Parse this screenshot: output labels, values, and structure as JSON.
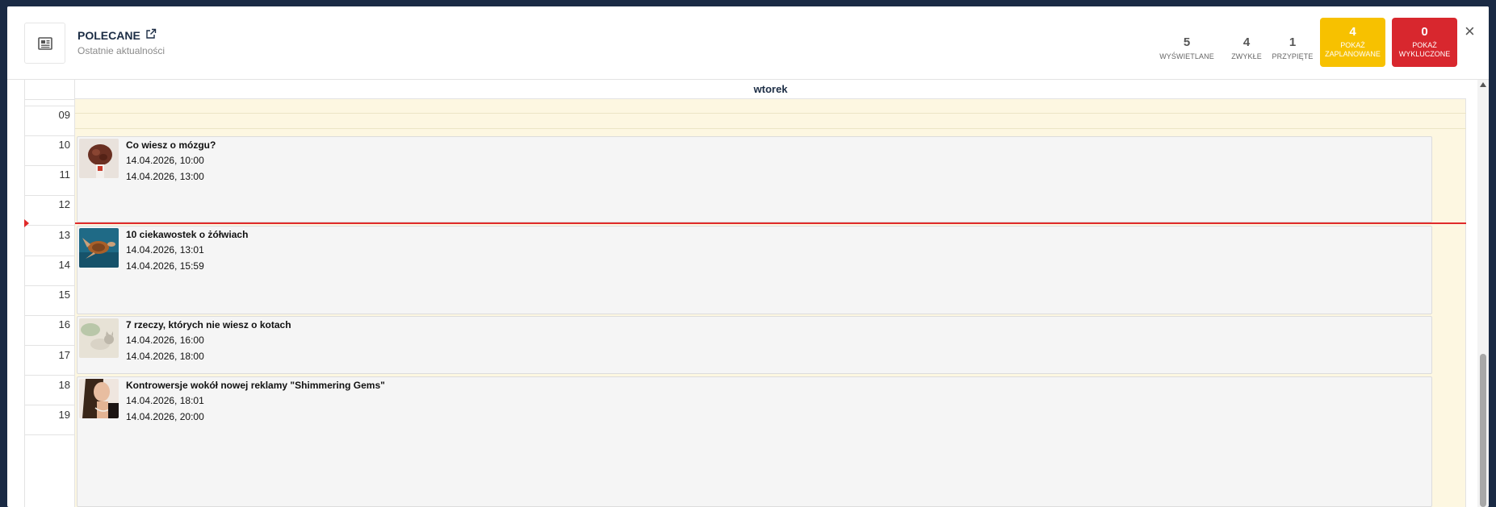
{
  "header": {
    "title": "POLECANE",
    "subtitle": "Ostatnie aktualności",
    "stats": [
      {
        "num": "5",
        "label": "WYŚWIETLANE"
      },
      {
        "num": "4",
        "label": "ZWYKŁE"
      },
      {
        "num": "1",
        "label": "PRZYPIĘTE"
      }
    ],
    "btn_planned": {
      "num": "4",
      "label1": "POKAŻ",
      "label2": "ZAPLANOWANE",
      "color": "#f7c100"
    },
    "btn_excluded": {
      "num": "0",
      "label1": "POKAŻ",
      "label2": "WYKLUCZONE",
      "color": "#d8272e"
    },
    "close": "×"
  },
  "calendar": {
    "day": "wtorek",
    "hours": [
      "09",
      "10",
      "11",
      "12",
      "13",
      "14",
      "15",
      "16",
      "17",
      "18",
      "19"
    ],
    "events": [
      {
        "title": "Co wiesz o mózgu?",
        "start": "14.04.2026, 10:00",
        "end": "14.04.2026, 13:00",
        "thumb": "brain"
      },
      {
        "title": "10 ciekawostek o żółwiach",
        "start": "14.04.2026, 13:01",
        "end": "14.04.2026, 15:59",
        "thumb": "turtle"
      },
      {
        "title": "7 rzeczy, których nie wiesz o kotach",
        "start": "14.04.2026, 16:00",
        "end": "14.04.2026, 18:00",
        "thumb": "cat"
      },
      {
        "title": "Kontrowersje wokół nowej reklamy \"Shimmering Gems\"",
        "start": "14.04.2026, 18:01",
        "end": "14.04.2026, 20:00",
        "thumb": "woman"
      }
    ]
  }
}
